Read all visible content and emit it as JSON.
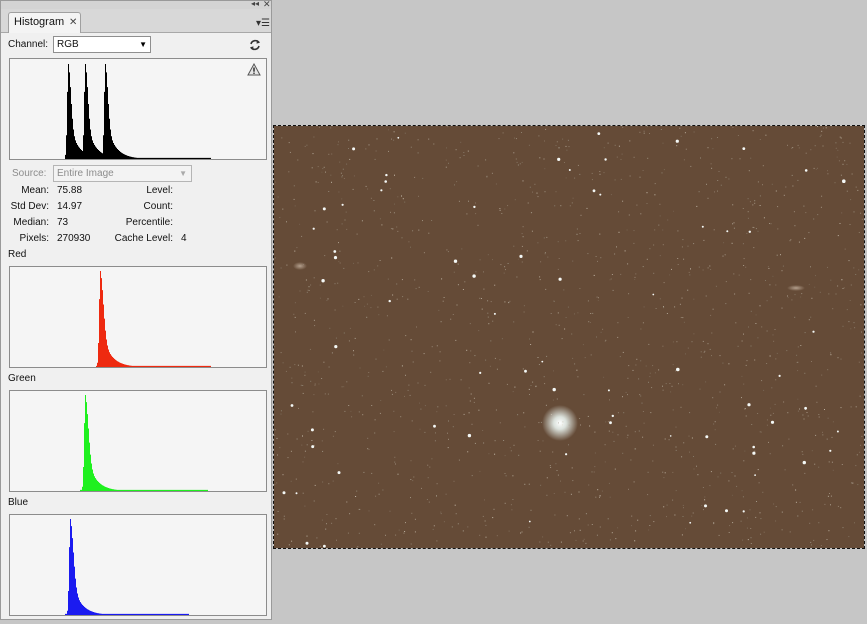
{
  "panel": {
    "tab_title": "Histogram",
    "channel_label": "Channel:",
    "channel_value": "RGB",
    "source_label": "Source:",
    "source_value": "Entire Image",
    "stats": {
      "mean_label": "Mean:",
      "mean_value": "75.88",
      "stddev_label": "Std Dev:",
      "stddev_value": "14.97",
      "median_label": "Median:",
      "median_value": "73",
      "pixels_label": "Pixels:",
      "pixels_value": "270930",
      "level_label": "Level:",
      "count_label": "Count:",
      "percentile_label": "Percentile:",
      "cache_label": "Cache Level:",
      "cache_value": "4"
    },
    "channels": {
      "red_label": "Red",
      "green_label": "Green",
      "blue_label": "Blue"
    }
  },
  "colors": {
    "rgb": "#000000",
    "red": "#ee2a10",
    "green": "#1ff01f",
    "blue": "#1b1bf0",
    "document_bg": "#654b37"
  },
  "histograms": {
    "rgb": {
      "peaks": [
        [
          58,
          0.97,
          2.5
        ],
        [
          75,
          0.97,
          2.5
        ],
        [
          95,
          0.97,
          2.5
        ]
      ],
      "start": 55,
      "end": 200
    },
    "red": {
      "peaks": [
        [
          90,
          0.98,
          3.0
        ]
      ],
      "start": 86,
      "end": 200
    },
    "green": {
      "peaks": [
        [
          75,
          0.98,
          3.0
        ]
      ],
      "start": 70,
      "end": 197
    },
    "blue": {
      "peaks": [
        [
          60,
          0.98,
          3.0
        ]
      ],
      "start": 55,
      "end": 178
    }
  },
  "icons": {
    "refresh": "refresh-icon",
    "warning": "cached-data-warning-icon",
    "panel_menu": "panel-menu-icon",
    "tab_close": "close-icon"
  }
}
